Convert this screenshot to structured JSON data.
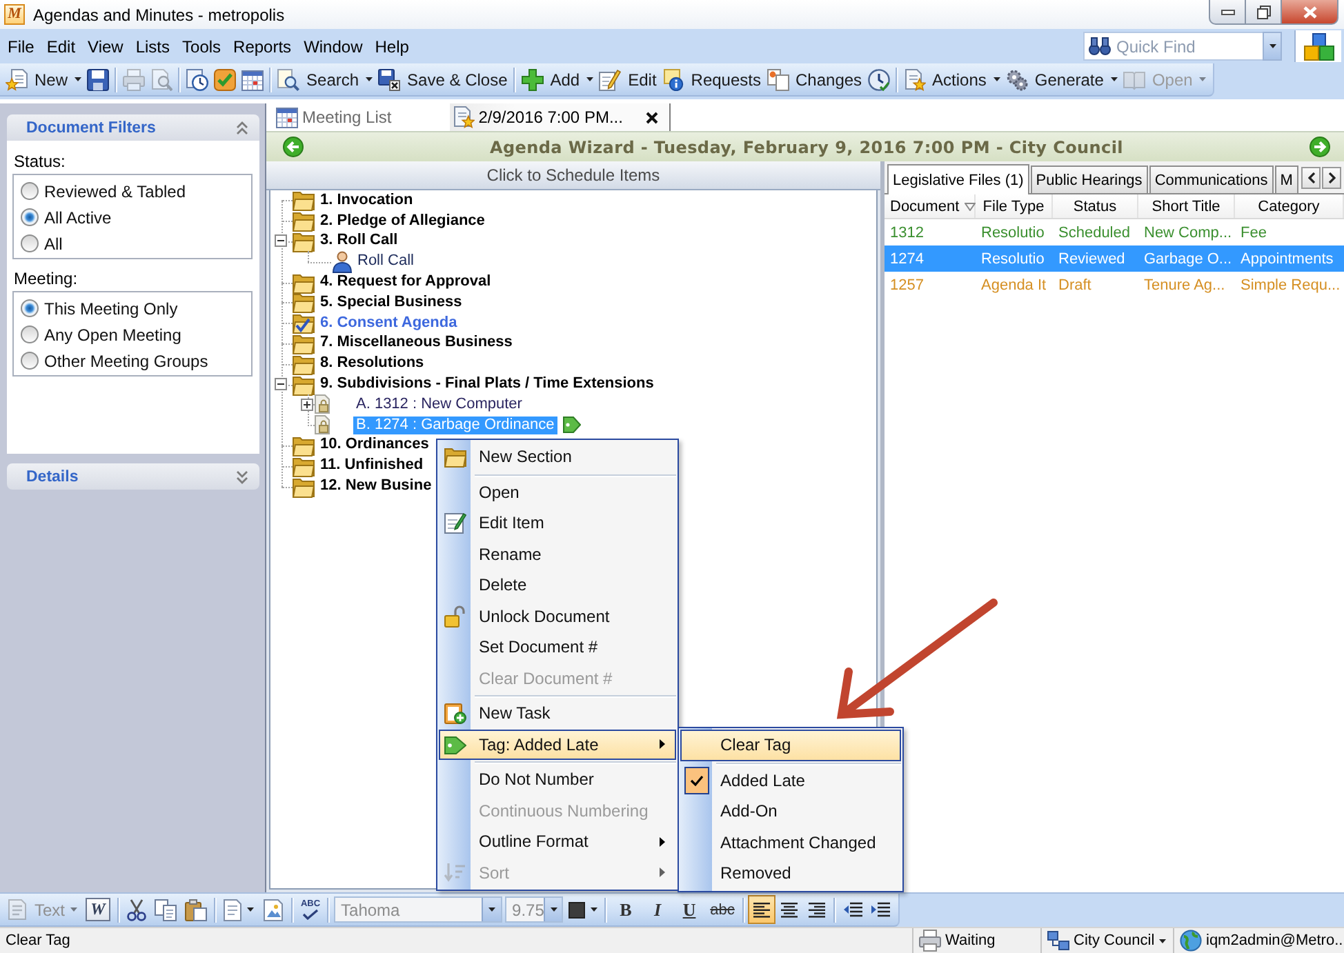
{
  "window": {
    "logo": "M",
    "title": "Agendas and Minutes - metropolis"
  },
  "menu_bar": {
    "items": [
      "File",
      "Edit",
      "View",
      "Lists",
      "Tools",
      "Reports",
      "Window",
      "Help"
    ],
    "quick_find": {
      "placeholder": "Quick Find"
    }
  },
  "toolbar": [
    {
      "kind": "button",
      "label": "New",
      "dropdown": true,
      "disabled": false
    },
    {
      "kind": "icon",
      "disabled": false
    },
    {
      "kind": "separator"
    },
    {
      "kind": "icon",
      "disabled": true
    },
    {
      "kind": "icon",
      "disabled": true
    },
    {
      "kind": "separator"
    },
    {
      "kind": "icon",
      "disabled": false
    },
    {
      "kind": "icon",
      "disabled": false
    },
    {
      "kind": "icon",
      "disabled": false
    },
    {
      "kind": "separator"
    },
    {
      "kind": "button",
      "label": "Search",
      "dropdown": true,
      "disabled": false
    },
    {
      "kind": "button",
      "label": "Save & Close",
      "disabled": false
    },
    {
      "kind": "separator"
    },
    {
      "kind": "button",
      "label": "Add",
      "dropdown": true,
      "disabled": false
    },
    {
      "kind": "button",
      "label": "Edit",
      "disabled": false
    },
    {
      "kind": "button",
      "label": "Requests",
      "disabled": false
    },
    {
      "kind": "button",
      "label": "Changes",
      "disabled": false
    },
    {
      "kind": "icon",
      "disabled": false
    },
    {
      "kind": "separator"
    },
    {
      "kind": "button",
      "label": "Actions",
      "dropdown": true,
      "disabled": false
    },
    {
      "kind": "button",
      "label": "Generate",
      "dropdown": true,
      "disabled": false
    },
    {
      "kind": "button",
      "label": "Open",
      "dropdown": true,
      "disabled": true
    }
  ],
  "document_filters": {
    "title": "Document Filters",
    "expanded": true,
    "groups": [
      {
        "label": "Status:",
        "options": [
          {
            "label": "Reviewed & Tabled",
            "selected": false
          },
          {
            "label": "All Active",
            "selected": true
          },
          {
            "label": "All",
            "selected": false
          }
        ]
      },
      {
        "label": "Meeting:",
        "options": [
          {
            "label": "This Meeting Only",
            "selected": true
          },
          {
            "label": "Any Open Meeting",
            "selected": false
          },
          {
            "label": "Other Meeting Groups",
            "selected": false
          }
        ]
      }
    ]
  },
  "details": {
    "title": "Details",
    "expanded": false
  },
  "document_tabs": [
    {
      "label": "Meeting List",
      "selected": false
    },
    {
      "label": "2/9/2016 7:00 PM...",
      "selected": true,
      "closable": true
    }
  ],
  "wizard": {
    "title": "Agenda Wizard - Tuesday, February 9, 2016 7:00 PM - City Council"
  },
  "schedule_tree": {
    "header": "Click to Schedule Items",
    "items": [
      {
        "label": "1. Invocation",
        "kind": "section",
        "selected": false
      },
      {
        "label": "2. Pledge of Allegiance",
        "kind": "section",
        "selected": false
      },
      {
        "label": "3. Roll Call",
        "kind": "section",
        "selected": false,
        "expanded": true,
        "children": [
          {
            "label": "Roll Call",
            "kind": "attendance",
            "selected": false
          }
        ]
      },
      {
        "label": "4. Request for Approval",
        "kind": "section",
        "selected": false
      },
      {
        "label": "5. Special Business",
        "kind": "section",
        "selected": false
      },
      {
        "label": "6. Consent Agenda",
        "kind": "consent",
        "selected": false
      },
      {
        "label": "7. Miscellaneous Business",
        "kind": "section",
        "selected": false
      },
      {
        "label": "8. Resolutions",
        "kind": "section",
        "selected": false
      },
      {
        "label": "9. Subdivisions - Final Plats / Time Extensions",
        "kind": "section",
        "selected": false,
        "expanded": true,
        "children": [
          {
            "label": "A. 1312 : New Computer",
            "kind": "document",
            "selected": false,
            "expanded": false,
            "tagged": false
          },
          {
            "label": "B. 1274 : Garbage Ordinance",
            "kind": "document",
            "selected": true,
            "tagged": true
          }
        ]
      },
      {
        "label": "10. Ordinances",
        "kind": "section",
        "selected": false
      },
      {
        "label": "11. Unfinished",
        "kind": "section",
        "selected": false
      },
      {
        "label": "12. New Busine",
        "kind": "section",
        "selected": false
      }
    ]
  },
  "legislative_tabs": [
    {
      "label": "Legislative Files (1)",
      "selected": true
    },
    {
      "label": "Public Hearings",
      "selected": false
    },
    {
      "label": "Communications",
      "selected": false
    },
    {
      "label": "M",
      "selected": false
    }
  ],
  "legislative_files": {
    "columns": [
      {
        "label": "Document",
        "sorted": true
      },
      {
        "label": "File Type",
        "sorted": false
      },
      {
        "label": "Status",
        "sorted": false
      },
      {
        "label": "Short Title",
        "sorted": false
      },
      {
        "label": "Category",
        "sorted": false
      }
    ],
    "rows": [
      {
        "cells": [
          "1312",
          "Resolutio",
          "Scheduled",
          "New Comp...",
          "Fee"
        ],
        "color": "#3a8f2e",
        "selected": false
      },
      {
        "cells": [
          "1274",
          "Resolutio",
          "Reviewed",
          "Garbage O...",
          "Appointments"
        ],
        "selected": true
      },
      {
        "cells": [
          "1257",
          "Agenda It",
          "Draft",
          "Tenure Ag...",
          "Simple Requ..."
        ],
        "color": "#d58f22",
        "selected": false
      }
    ]
  },
  "context_menu": {
    "items": [
      {
        "kind": "item",
        "label": "New Section",
        "disabled": false,
        "selected": false
      },
      {
        "kind": "separator"
      },
      {
        "kind": "item",
        "label": "Open",
        "disabled": false,
        "selected": false
      },
      {
        "kind": "item",
        "label": "Edit Item",
        "disabled": false,
        "selected": false
      },
      {
        "kind": "item",
        "label": "Rename",
        "disabled": false,
        "selected": false
      },
      {
        "kind": "item",
        "label": "Delete",
        "disabled": false,
        "selected": false
      },
      {
        "kind": "item",
        "label": "Unlock Document",
        "disabled": false,
        "selected": false
      },
      {
        "kind": "item",
        "label": "Set Document #",
        "disabled": false,
        "selected": false
      },
      {
        "kind": "item",
        "label": "Clear Document #",
        "disabled": true,
        "selected": false
      },
      {
        "kind": "separator"
      },
      {
        "kind": "item",
        "label": "New Task",
        "disabled": false,
        "selected": false
      },
      {
        "kind": "item",
        "label": "Tag: Added Late",
        "disabled": false,
        "selected": true,
        "has_submenu": true
      },
      {
        "kind": "separator"
      },
      {
        "kind": "item",
        "label": "Do Not Number",
        "disabled": false,
        "selected": false
      },
      {
        "kind": "item",
        "label": "Continuous Numbering",
        "disabled": true,
        "selected": false
      },
      {
        "kind": "item",
        "label": "Outline Format",
        "disabled": false,
        "selected": false,
        "has_submenu": true
      },
      {
        "kind": "item",
        "label": "Sort",
        "disabled": true,
        "selected": false,
        "has_submenu": true
      }
    ],
    "submenu": {
      "items": [
        {
          "kind": "item",
          "label": "Clear Tag",
          "selected": true,
          "checked": false
        },
        {
          "kind": "separator"
        },
        {
          "kind": "item",
          "label": "Added Late",
          "selected": false,
          "checked": true
        },
        {
          "kind": "item",
          "label": "Add-On",
          "selected": false,
          "checked": false
        },
        {
          "kind": "item",
          "label": "Attachment Changed",
          "selected": false,
          "checked": false
        },
        {
          "kind": "item",
          "label": "Removed",
          "selected": false,
          "checked": false
        }
      ]
    }
  },
  "format_toolbar": [
    {
      "kind": "dropdown",
      "label": "Text",
      "disabled": true
    },
    {
      "kind": "letter",
      "label": "W"
    },
    {
      "kind": "separator"
    },
    {
      "kind": "icon"
    },
    {
      "kind": "icon"
    },
    {
      "kind": "icon"
    },
    {
      "kind": "separator"
    },
    {
      "kind": "icon",
      "dropdown": true
    },
    {
      "kind": "icon"
    },
    {
      "kind": "separator"
    },
    {
      "kind": "spell",
      "label": "ABC"
    },
    {
      "kind": "separator"
    },
    {
      "kind": "font",
      "value": "Tahoma",
      "disabled": true
    },
    {
      "kind": "size",
      "value": "9.75",
      "disabled": true
    },
    {
      "kind": "color",
      "dropdown": true
    },
    {
      "kind": "separator"
    },
    {
      "kind": "bold",
      "label": "B"
    },
    {
      "kind": "italic",
      "label": "I"
    },
    {
      "kind": "underline",
      "label": "U"
    },
    {
      "kind": "strike",
      "label": "abc"
    },
    {
      "kind": "separator"
    },
    {
      "kind": "align",
      "selected": true
    },
    {
      "kind": "align",
      "selected": false
    },
    {
      "kind": "align",
      "selected": false
    },
    {
      "kind": "separator"
    },
    {
      "kind": "icon"
    },
    {
      "kind": "icon"
    }
  ],
  "status_bar": {
    "message": "Clear Tag",
    "items": [
      {
        "label": "Waiting"
      },
      {
        "label": "City Council",
        "dropdown": true
      },
      {
        "label": "iqm2admin@Metro..."
      }
    ]
  }
}
